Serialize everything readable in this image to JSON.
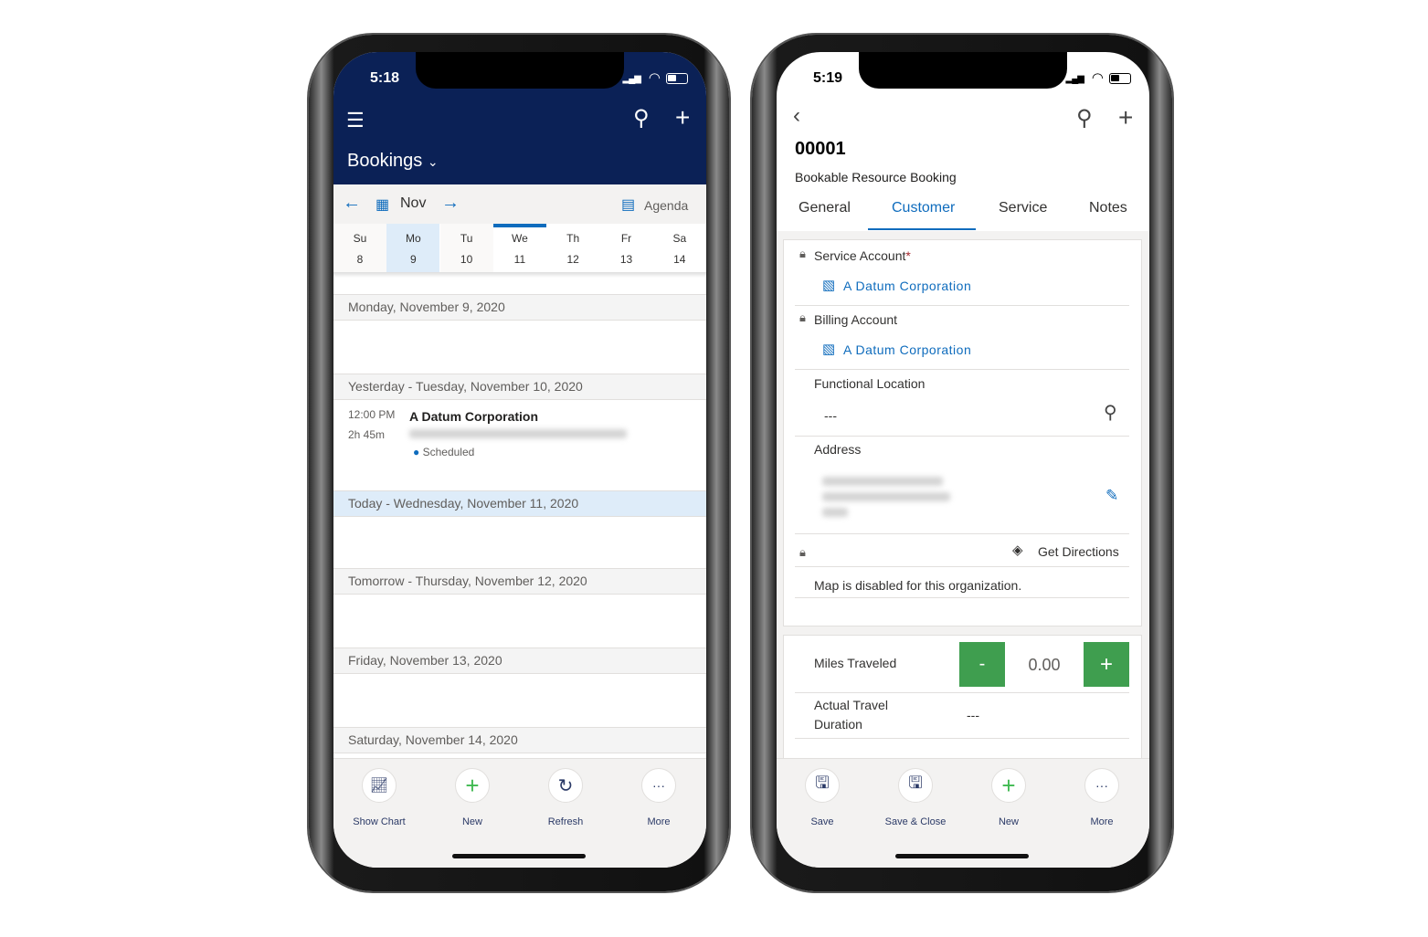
{
  "left_phone": {
    "status": {
      "time": "5:18"
    },
    "header": {
      "title": "Bookings",
      "menu_icon": "hamburger-icon",
      "search_icon": "search-icon",
      "add_icon": "plus-icon"
    },
    "date_nav": {
      "month": "Nov",
      "view": "Agenda"
    },
    "week": [
      {
        "d": "Su",
        "n": "8"
      },
      {
        "d": "Mo",
        "n": "9"
      },
      {
        "d": "Tu",
        "n": "10"
      },
      {
        "d": "We",
        "n": "11"
      },
      {
        "d": "Th",
        "n": "12"
      },
      {
        "d": "Fr",
        "n": "13"
      },
      {
        "d": "Sa",
        "n": "14"
      }
    ],
    "days": [
      "Monday, November 9, 2020",
      "Yesterday - Tuesday, November 10, 2020",
      "Today - Wednesday, November 11, 2020",
      "Tomorrow - Thursday, November 12, 2020",
      "Friday, November 13, 2020",
      "Saturday, November 14, 2020"
    ],
    "booking": {
      "time": "12:00 PM",
      "duration": "2h 45m",
      "title": "A Datum Corporation",
      "status": "Scheduled"
    },
    "toolbar": [
      "Show Chart",
      "New",
      "Refresh",
      "More"
    ]
  },
  "right_phone": {
    "status": {
      "time": "5:19"
    },
    "record": {
      "id": "00001",
      "entity": "Bookable Resource Booking"
    },
    "tabs": [
      "General",
      "Customer",
      "Service",
      "Notes"
    ],
    "active_tab": "Customer",
    "fields": {
      "service_account_label": "Service Account",
      "required_mark": "*",
      "service_account": "A Datum Corporation",
      "billing_account_label": "Billing Account",
      "billing_account": "A Datum Corporation",
      "functional_location_label": "Functional Location",
      "functional_location": "---",
      "address_label": "Address",
      "get_directions": "Get Directions",
      "map_message": "Map is disabled for this organization.",
      "miles_label": "Miles Traveled",
      "miles_value": "0.00",
      "minus": "-",
      "plus": "+",
      "travel_duration_label": "Actual Travel Duration",
      "travel_duration": "---"
    },
    "toolbar": [
      "Save",
      "Save & Close",
      "New",
      "More"
    ]
  },
  "colors": {
    "navy": "#0b2156",
    "accent": "#0f6cbd",
    "green": "#3f9e4f",
    "selected_day": "#deecf9"
  }
}
